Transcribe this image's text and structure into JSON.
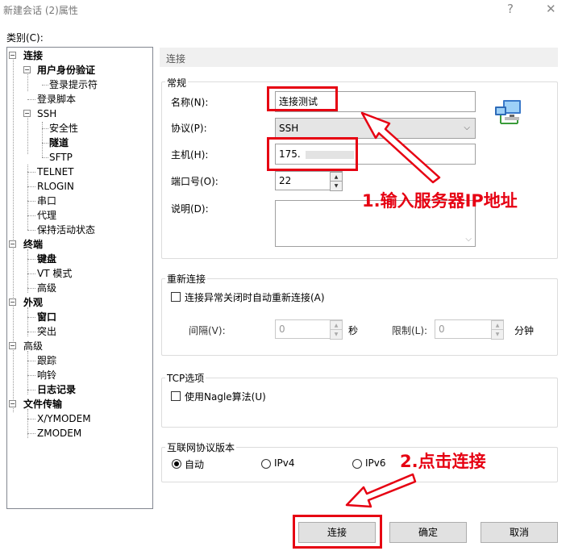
{
  "window": {
    "title": "新建会话 (2)属性",
    "help_label": "?",
    "close_label": "✕"
  },
  "category_label": "类别(C):",
  "tree": {
    "connection": "连接",
    "user_auth": "用户身份验证",
    "login_prompt": "登录提示符",
    "login_script": "登录脚本",
    "ssh": "SSH",
    "security": "安全性",
    "tunnel": "隧道",
    "sftp": "SFTP",
    "telnet": "TELNET",
    "rlogin": "RLOGIN",
    "serial": "串口",
    "proxy": "代理",
    "keepalive": "保持活动状态",
    "terminal": "终端",
    "keyboard": "键盘",
    "vt_mode": "VT 模式",
    "advanced": "高级",
    "appearance": "外观",
    "window": "窗口",
    "highlight": "突出",
    "advanced2": "高级",
    "trace": "跟踪",
    "bell": "响铃",
    "logging": "日志记录",
    "file_transfer": "文件传输",
    "xymodem": "X/YMODEM",
    "zmodem": "ZMODEM"
  },
  "page_header": "连接",
  "general": {
    "label": "常规",
    "name_label": "名称(N):",
    "name_value": "连接测试",
    "protocol_label": "协议(P):",
    "protocol_value": "SSH",
    "host_label": "主机(H):",
    "host_value": "175.",
    "port_label": "端口号(O):",
    "port_value": "22",
    "desc_label": "说明(D):"
  },
  "reconnect": {
    "label": "重新连接",
    "checkbox_label": "连接异常关闭时自动重新连接(A)",
    "interval_label": "间隔(V):",
    "interval_value": "0",
    "interval_unit": "秒",
    "limit_label": "限制(L):",
    "limit_value": "0",
    "limit_unit": "分钟"
  },
  "tcp": {
    "label": "TCP选项",
    "nagle_label": "使用Nagle算法(U)"
  },
  "ip_version": {
    "label": "互联网协议版本",
    "auto": "自动",
    "ipv4": "IPv4",
    "ipv6": "IPv6",
    "selected": "自动"
  },
  "buttons": {
    "connect": "连接",
    "ok": "确定",
    "cancel": "取消"
  },
  "annotations": {
    "step1": "1.输入服务器IP地址",
    "step2": "2.点击连接",
    "color": "#e60012"
  }
}
